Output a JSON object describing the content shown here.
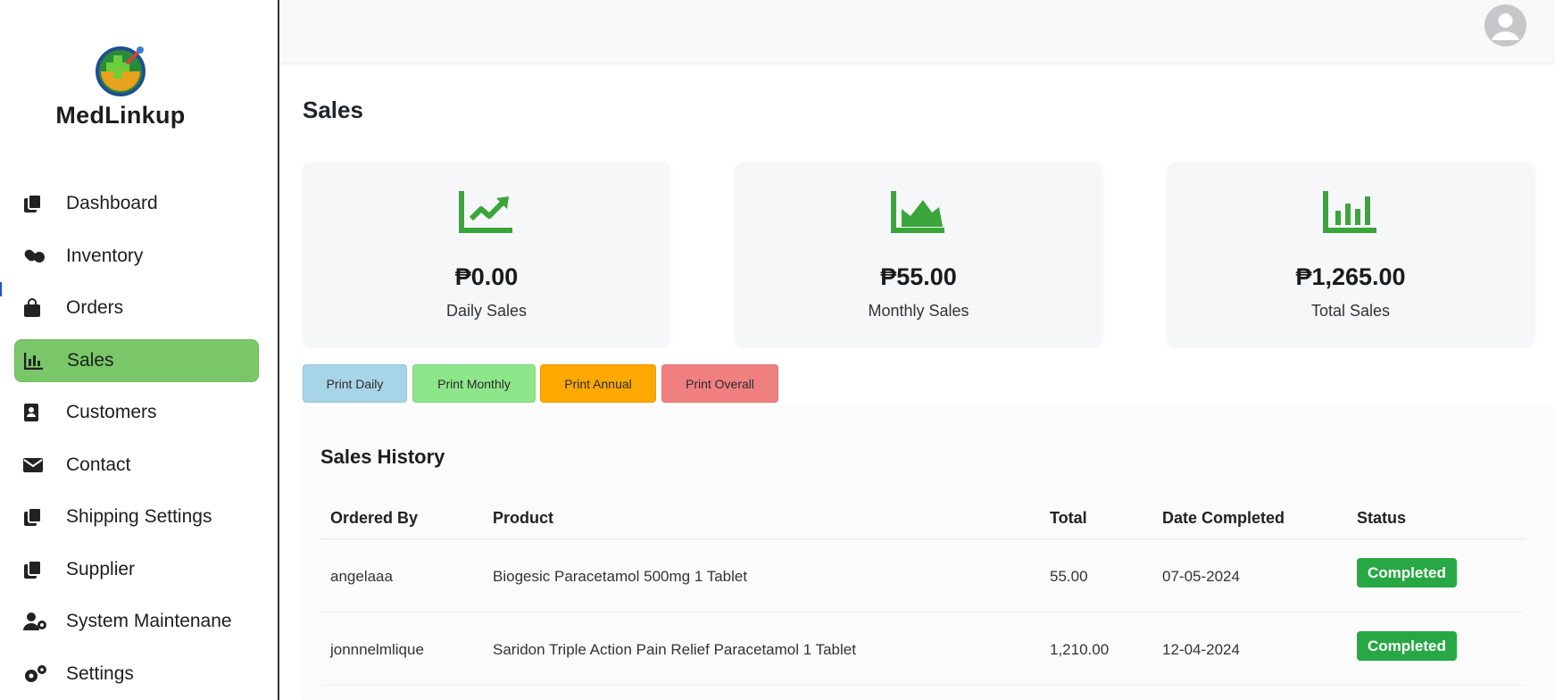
{
  "brand": {
    "name": "MedLinkup"
  },
  "sidebar": {
    "items": [
      {
        "label": "Dashboard",
        "icon": "copy-icon"
      },
      {
        "label": "Inventory",
        "icon": "pills-icon"
      },
      {
        "label": "Orders",
        "icon": "shopping-bag-icon"
      },
      {
        "label": "Sales",
        "icon": "bar-chart-icon",
        "active": true
      },
      {
        "label": "Customers",
        "icon": "address-book-icon"
      },
      {
        "label": "Contact",
        "icon": "envelope-icon"
      },
      {
        "label": "Shipping Settings",
        "icon": "copy-icon"
      },
      {
        "label": "Supplier",
        "icon": "copy-icon"
      },
      {
        "label": "System Maintenane",
        "icon": "user-gear-icon"
      },
      {
        "label": "Settings",
        "icon": "gears-icon"
      }
    ]
  },
  "header": {
    "avatar_icon": "user-avatar-icon"
  },
  "page": {
    "title": "Sales"
  },
  "cards": [
    {
      "value": "₱0.00",
      "label": "Daily Sales",
      "icon": "line-trend-icon"
    },
    {
      "value": "₱55.00",
      "label": "Monthly Sales",
      "icon": "area-chart-icon"
    },
    {
      "value": "₱1,265.00",
      "label": "Total Sales",
      "icon": "column-chart-icon"
    }
  ],
  "print_buttons": [
    {
      "label": "Print Daily",
      "color": "#a8d4e8"
    },
    {
      "label": "Print Monthly",
      "color": "#8ee68a"
    },
    {
      "label": "Print Annual",
      "color": "#ffa800"
    },
    {
      "label": "Print Overall",
      "color": "#f08080"
    }
  ],
  "history": {
    "title": "Sales History",
    "columns": [
      "Ordered By",
      "Product",
      "Total",
      "Date Completed",
      "Status"
    ],
    "rows": [
      {
        "ordered_by": "angelaaa",
        "product": "Biogesic Paracetamol 500mg 1 Tablet",
        "total": "55.00",
        "date": "07-05-2024",
        "status": "Completed"
      },
      {
        "ordered_by": "jonnnelmlique",
        "product": "Saridon Triple Action Pain Relief Paracetamol 1 Tablet",
        "total": "1,210.00",
        "date": "12-04-2024",
        "status": "Completed"
      }
    ]
  },
  "colors": {
    "accent_green": "#3aa63a",
    "active_nav": "#7ac769",
    "status_badge": "#28a745"
  }
}
